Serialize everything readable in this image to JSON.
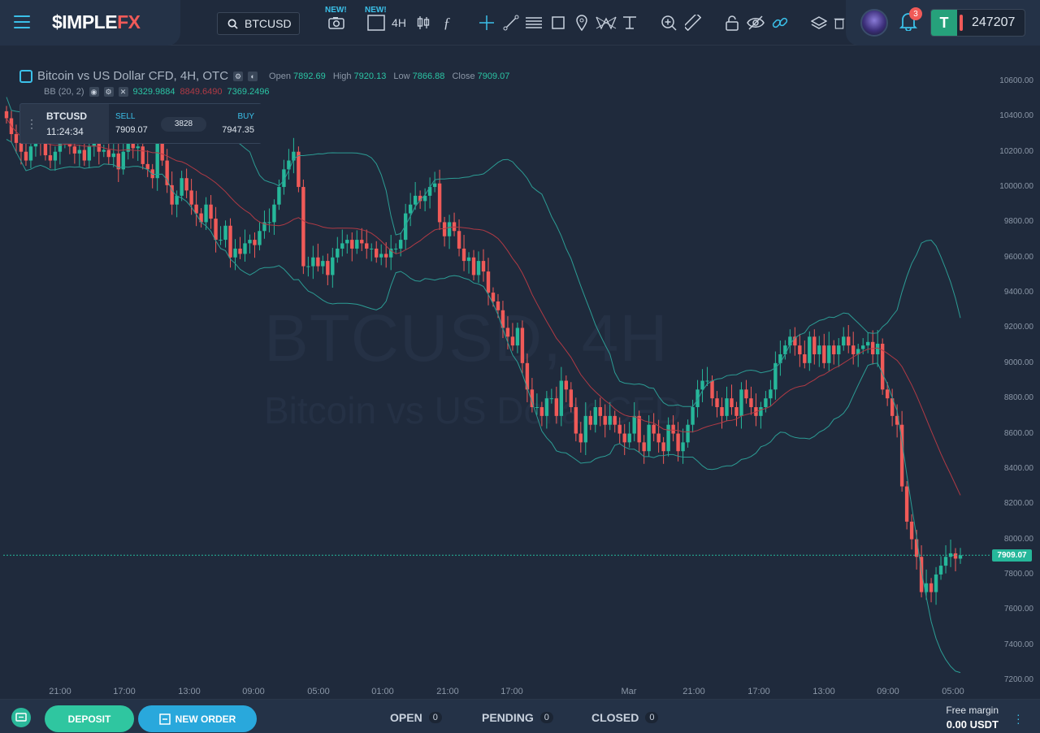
{
  "brand": {
    "name_main": "$IMPLE",
    "name_accent": "FX"
  },
  "toolbar": {
    "symbol": "BTCUSD",
    "new_label_1": "NEW!",
    "new_label_2": "NEW!",
    "timeframe": "4H",
    "tools": [
      "camera-icon",
      "rectangle-layout-icon",
      "timeframe",
      "candles-icon",
      "function-icon",
      "crosshair-icon",
      "trendline-icon",
      "fib-icon",
      "rect-icon",
      "pin-icon",
      "pattern-icon",
      "text-icon",
      "zoom-icon",
      "ruler-icon",
      "lock-icon",
      "eye-icon",
      "link-icon",
      "layers-icon",
      "trash-icon"
    ]
  },
  "user": {
    "notifications": "3",
    "account_currency_icon": "T",
    "account_number": "247207"
  },
  "chart": {
    "title": "Bitcoin vs US Dollar CFD, 4H, OTC",
    "open_label": "Open",
    "open": "7892.69",
    "high_label": "High",
    "high": "7920.13",
    "low_label": "Low",
    "low": "7866.88",
    "close_label": "Close",
    "close": "7909.07",
    "bb_label": "BB (20, 2)",
    "bb_upper": "9329.9884",
    "bb_mid": "8849.6490",
    "bb_lower": "7369.2496",
    "watermark_symbol": "BTCUSD, 4H",
    "watermark_name": "Bitcoin vs US Dollar CFD",
    "current_price": "7909.07",
    "colors": {
      "up": "#26b79a",
      "down": "#f05a58",
      "band": "#2c9c94",
      "mid": "#b03a45"
    }
  },
  "ticker": {
    "symbol": "BTCUSD",
    "time": "11:24:34",
    "sell_label": "SELL",
    "sell": "7909.07",
    "spread": "3828",
    "buy_label": "BUY",
    "buy": "7947.35"
  },
  "chart_data": {
    "type": "candlestick",
    "ylim": [
      7200,
      10700
    ],
    "y_ticks": [
      "10600.00",
      "10400.00",
      "10200.00",
      "10000.00",
      "9800.00",
      "9600.00",
      "9400.00",
      "9200.00",
      "9000.00",
      "8800.00",
      "8600.00",
      "8400.00",
      "8200.00",
      "8000.00",
      "7800.00",
      "7600.00",
      "7400.00",
      "7200.00"
    ],
    "x_ticks": [
      "21:00",
      "17:00",
      "13:00",
      "09:00",
      "05:00",
      "01:00",
      "21:00",
      "17:00",
      "Mar",
      "21:00",
      "17:00",
      "13:00",
      "09:00",
      "05:00"
    ],
    "close_series": [
      10390,
      10300,
      10250,
      10200,
      10150,
      10230,
      10300,
      10250,
      10180,
      10150,
      10200,
      10250,
      10300,
      10230,
      10190,
      10210,
      10150,
      10230,
      10250,
      10200,
      10210,
      10170,
      10190,
      10100,
      10200,
      10280,
      10220,
      10230,
      10130,
      10100,
      10050,
      10250,
      10150,
      10010,
      9900,
      9950,
      10050,
      9980,
      9900,
      9850,
      9800,
      9900,
      9820,
      9700,
      9700,
      9780,
      9600,
      9650,
      9620,
      9680,
      9700,
      9670,
      9750,
      9800,
      9800,
      9900,
      10000,
      10100,
      10150,
      10200,
      10000,
      9550,
      9550,
      9600,
      9550,
      9580,
      9500,
      9600,
      9650,
      9680,
      9700,
      9650,
      9700,
      9680,
      9650,
      9650,
      9600,
      9620,
      9600,
      9650,
      9650,
      9700,
      9850,
      9900,
      9950,
      9920,
      9950,
      10000,
      10020,
      9800,
      9720,
      9800,
      9750,
      9650,
      9580,
      9600,
      9500,
      9580,
      9520,
      9400,
      9350,
      9300,
      9200,
      9150,
      9100,
      9200,
      9000,
      8850,
      8750,
      8750,
      8700,
      8800,
      8800,
      8700,
      8900,
      8850,
      8750,
      8600,
      8550,
      8700,
      8650,
      8750,
      8700,
      8650,
      8700,
      8650,
      8600,
      8550,
      8600,
      8700,
      8550,
      8500,
      8650,
      8600,
      8550,
      8500,
      8650,
      8600,
      8500,
      8550,
      8650,
      8750,
      8850,
      8900,
      8900,
      8800,
      8750,
      8700,
      8800,
      8750,
      8700,
      8850,
      8800,
      8750,
      8700,
      8750,
      8800,
      8850,
      9000,
      9050,
      9100,
      9150,
      9100,
      9050,
      9000,
      9150,
      9050,
      9100,
      9000,
      9100,
      9050,
      9100,
      9150,
      9100,
      9050,
      9080,
      9100,
      9120,
      9050,
      9110,
      8850,
      8800,
      8700,
      8650,
      8300,
      8100,
      8000,
      7900,
      7700,
      7750,
      7700,
      7800,
      7850,
      7900,
      7920,
      7890,
      7909
    ]
  },
  "bottom": {
    "deposit": "DEPOSIT",
    "new_order": "NEW ORDER",
    "tabs": [
      {
        "label": "OPEN",
        "count": "0"
      },
      {
        "label": "PENDING",
        "count": "0"
      },
      {
        "label": "CLOSED",
        "count": "0"
      }
    ],
    "free_margin_label": "Free margin",
    "free_margin_value": "0.00 USDT"
  }
}
